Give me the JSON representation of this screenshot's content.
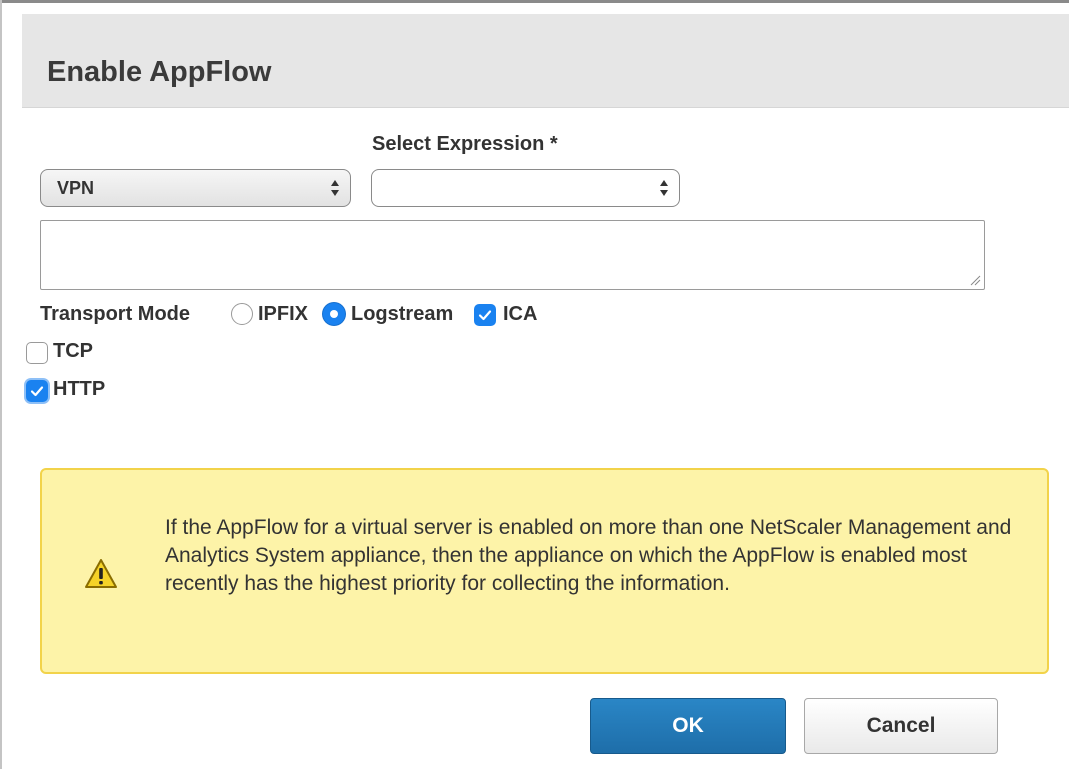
{
  "dialog": {
    "title": "Enable AppFlow"
  },
  "form": {
    "type_select": {
      "value": "VPN"
    },
    "expression": {
      "label": "Select Expression *",
      "value": ""
    },
    "expression_text": "",
    "transport_mode": {
      "label": "Transport Mode",
      "options": [
        {
          "label": "IPFIX",
          "selected": false
        },
        {
          "label": "Logstream",
          "selected": true
        }
      ]
    },
    "checkboxes": {
      "ica": {
        "label": "ICA",
        "checked": true
      },
      "tcp": {
        "label": "TCP",
        "checked": false
      },
      "http": {
        "label": "HTTP",
        "checked": true
      }
    }
  },
  "warning": {
    "icon": "warning-icon",
    "text": "If the AppFlow for a virtual server is enabled on more than one NetScaler Management and Analytics System appliance, then the appliance on which the AppFlow is enabled most recently has the highest priority for collecting the information."
  },
  "buttons": {
    "ok": "OK",
    "cancel": "Cancel"
  },
  "colors": {
    "accent": "#1a82f0",
    "ok_button": "#2378b8",
    "warning_bg": "#fdf3a8",
    "warning_border": "#f2d34a",
    "header_bg": "#e6e6e6"
  }
}
